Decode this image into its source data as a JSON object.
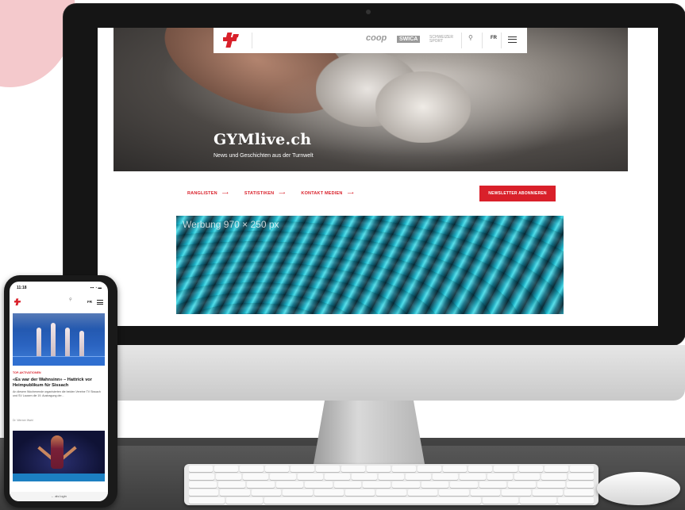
{
  "site": {
    "title": "GYMlive.ch",
    "subtitle": "News und Geschichten aus der Turnwelt"
  },
  "nav": {
    "sponsors": [
      "coop",
      "SWICA",
      "SCHWEIZER SPORT"
    ],
    "language": "FR"
  },
  "links": [
    {
      "label": "RANGLISTEN",
      "arrow": "⟶"
    },
    {
      "label": "STATISTIKEN",
      "arrow": "⟶"
    },
    {
      "label": "KONTAKT MEDIEN",
      "arrow": "⟶"
    }
  ],
  "newsletter_button": "NEWSLETTER ABONNIEREN",
  "ad": {
    "label": "Werbung 970 × 250 px"
  },
  "phone": {
    "time": "11:18",
    "status_icons": "▪▪▪ ◔ ▬",
    "language": "FR",
    "article": {
      "tag": "TOP-AKTIVATIONEN",
      "title": "«Es war der Wahnsinn» – Hattrick vor Heimpublikum für Sissach",
      "text": "An diesem Wochenende organisierten die beiden Vereine TV Sissach und SV Lausen die 19. Austragung der...",
      "author": "Dr. Werner Wahl"
    },
    "bottom": "← als login"
  },
  "colors": {
    "accent": "#d9202a",
    "pink_blob": "#f4c9cc"
  }
}
